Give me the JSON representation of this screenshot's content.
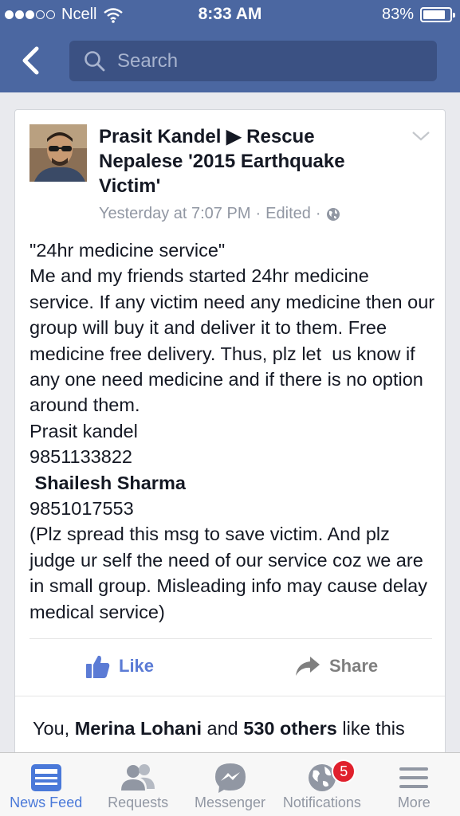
{
  "status_bar": {
    "carrier": "Ncell",
    "time": "8:33 AM",
    "battery": "83%",
    "battery_level": 0.83
  },
  "nav": {
    "search_placeholder": "Search"
  },
  "post": {
    "author_line": "Prasit Kandel ▶ Rescue Nepalese '2015 Earthquake Victim'",
    "timestamp": "Yesterday at 7:07 PM",
    "edited": "Edited",
    "separator": "·",
    "lines": [
      "\"24hr medicine service\"",
      "Me and my friends started 24hr medicine service. If any victim need any medicine then our group will buy it and deliver it to them. Free medicine free delivery. Thus, plz let  us know if any one need medicine and if there is no option around them.",
      "Prasit kandel",
      "9851133822",
      " Shailesh Sharma",
      "9851017553",
      "(Plz spread this msg to save victim. And plz judge ur self the need of our service coz we are in small group. Misleading info may cause delay medical service)"
    ],
    "like_label": "Like",
    "share_label": "Share",
    "likes": {
      "you": "You,",
      "name": "Merina Lohani",
      "and": "and",
      "others": "530 others",
      "tail": "like this"
    }
  },
  "tabbar": {
    "news_feed": "News Feed",
    "requests": "Requests",
    "messenger": "Messenger",
    "notifications": "Notifications",
    "notifications_badge": "5",
    "more": "More"
  }
}
